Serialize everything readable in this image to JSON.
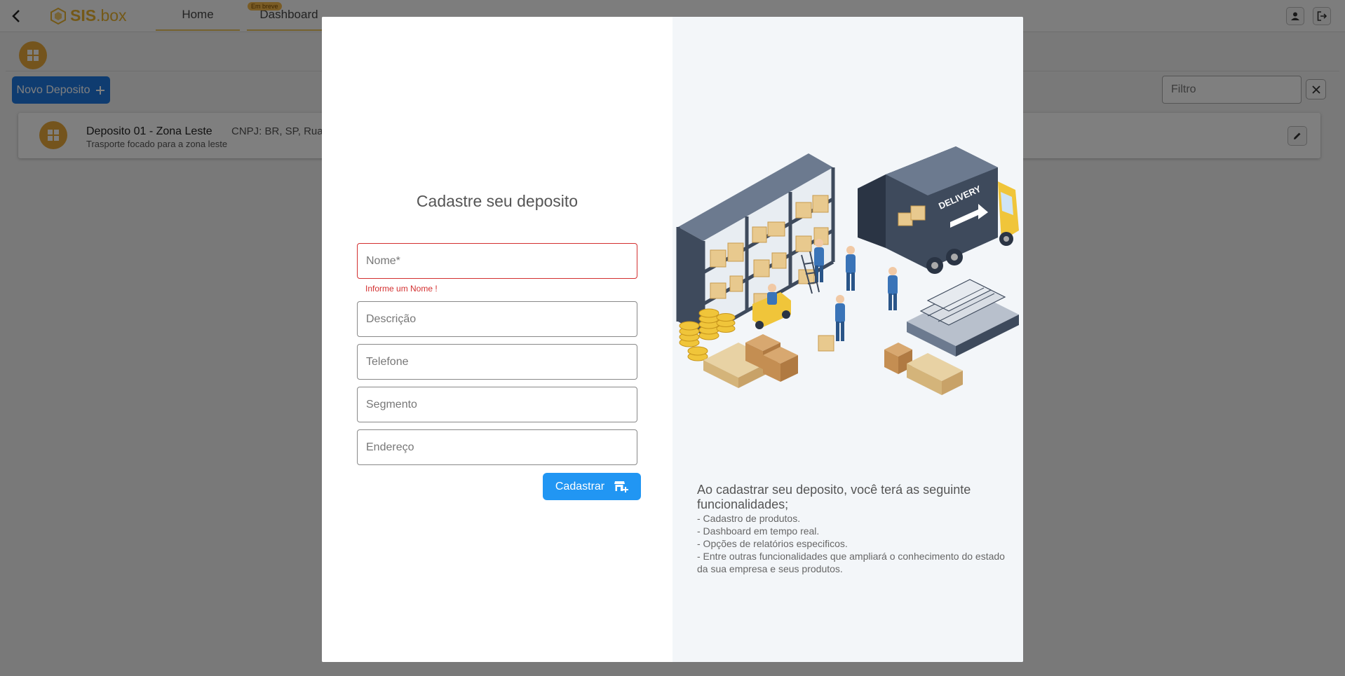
{
  "app": {
    "logo_text": "SIS",
    "logo_suffix": ".box",
    "nav": {
      "home_label": "Home",
      "dashboard_label": "Dashboard",
      "dashboard_badge": "Em breve"
    }
  },
  "page": {
    "new_button_label": "Novo Deposito",
    "filter_placeholder": "Filtro",
    "deposits": [
      {
        "title": "Deposito 01 - Zona Leste",
        "cnpj": "CNPJ: BR, SP, Rua",
        "description": "Trasporte focado para a zona leste"
      }
    ]
  },
  "modal": {
    "title": "Cadastre seu deposito",
    "fields": {
      "name_placeholder": "Nome*",
      "name_error": "Informe um Nome !",
      "description_placeholder": "Descrição",
      "phone_placeholder": "Telefone",
      "segment_placeholder": "Segmento",
      "address_placeholder": "Endereço"
    },
    "submit_label": "Cadastrar",
    "info": {
      "title": "Ao cadastrar seu deposito, você terá as seguinte funcionalidades;",
      "items": [
        " - Cadastro de produtos.",
        " - Dashboard em tempo real.",
        " - Opções de relatórios especificos.",
        " - Entre outras funcionalidades que ampliará o conhecimento do estado da sua empresa e seus produtos."
      ],
      "truck_text": "DELIVERY"
    }
  },
  "colors": {
    "primary": "#2196f3",
    "new_button": "#1e78e0",
    "accent": "#e8a93a",
    "error": "#d32f2f"
  }
}
